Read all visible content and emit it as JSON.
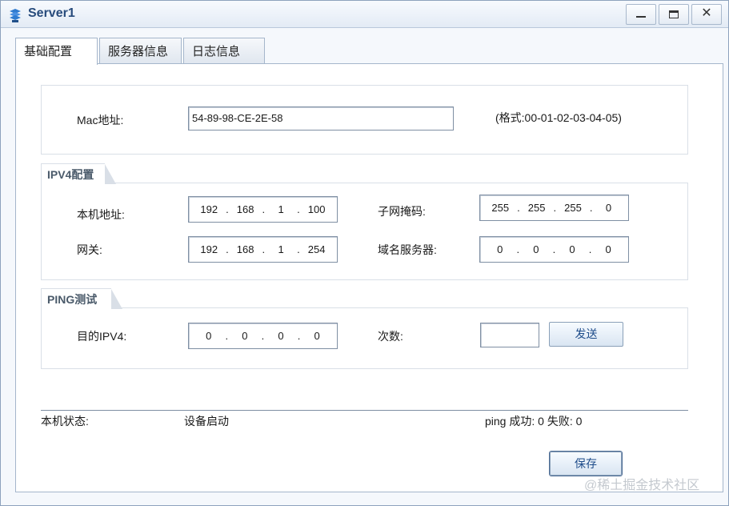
{
  "window": {
    "title": "Server1"
  },
  "tabs": [
    {
      "label": "基础配置",
      "active": true
    },
    {
      "label": "服务器信息",
      "active": false
    },
    {
      "label": "日志信息",
      "active": false
    }
  ],
  "mac": {
    "label": "Mac地址:",
    "value": "54-89-98-CE-2E-58",
    "format_hint": "(格式:00-01-02-03-04-05)"
  },
  "ipv4": {
    "group_title": "IPV4配置",
    "local_address": {
      "label": "本机地址:",
      "segments": [
        "192",
        "168",
        "1",
        "100"
      ]
    },
    "subnet_mask": {
      "label": "子网掩码:",
      "segments": [
        "255",
        "255",
        "255",
        "0"
      ]
    },
    "gateway": {
      "label": "网关:",
      "segments": [
        "192",
        "168",
        "1",
        "254"
      ]
    },
    "dns": {
      "label": "域名服务器:",
      "segments": [
        "0",
        "0",
        "0",
        "0"
      ]
    }
  },
  "ping": {
    "group_title": "PING测试",
    "target": {
      "label": "目的IPV4:",
      "segments": [
        "0",
        "0",
        "0",
        "0"
      ]
    },
    "count": {
      "label": "次数:",
      "value": ""
    },
    "send_label": "发送"
  },
  "status": {
    "label": "本机状态:",
    "value": "设备启动",
    "ping_result": "ping 成功: 0 失败: 0"
  },
  "save_label": "保存",
  "watermark": "@稀土掘金技术社区"
}
